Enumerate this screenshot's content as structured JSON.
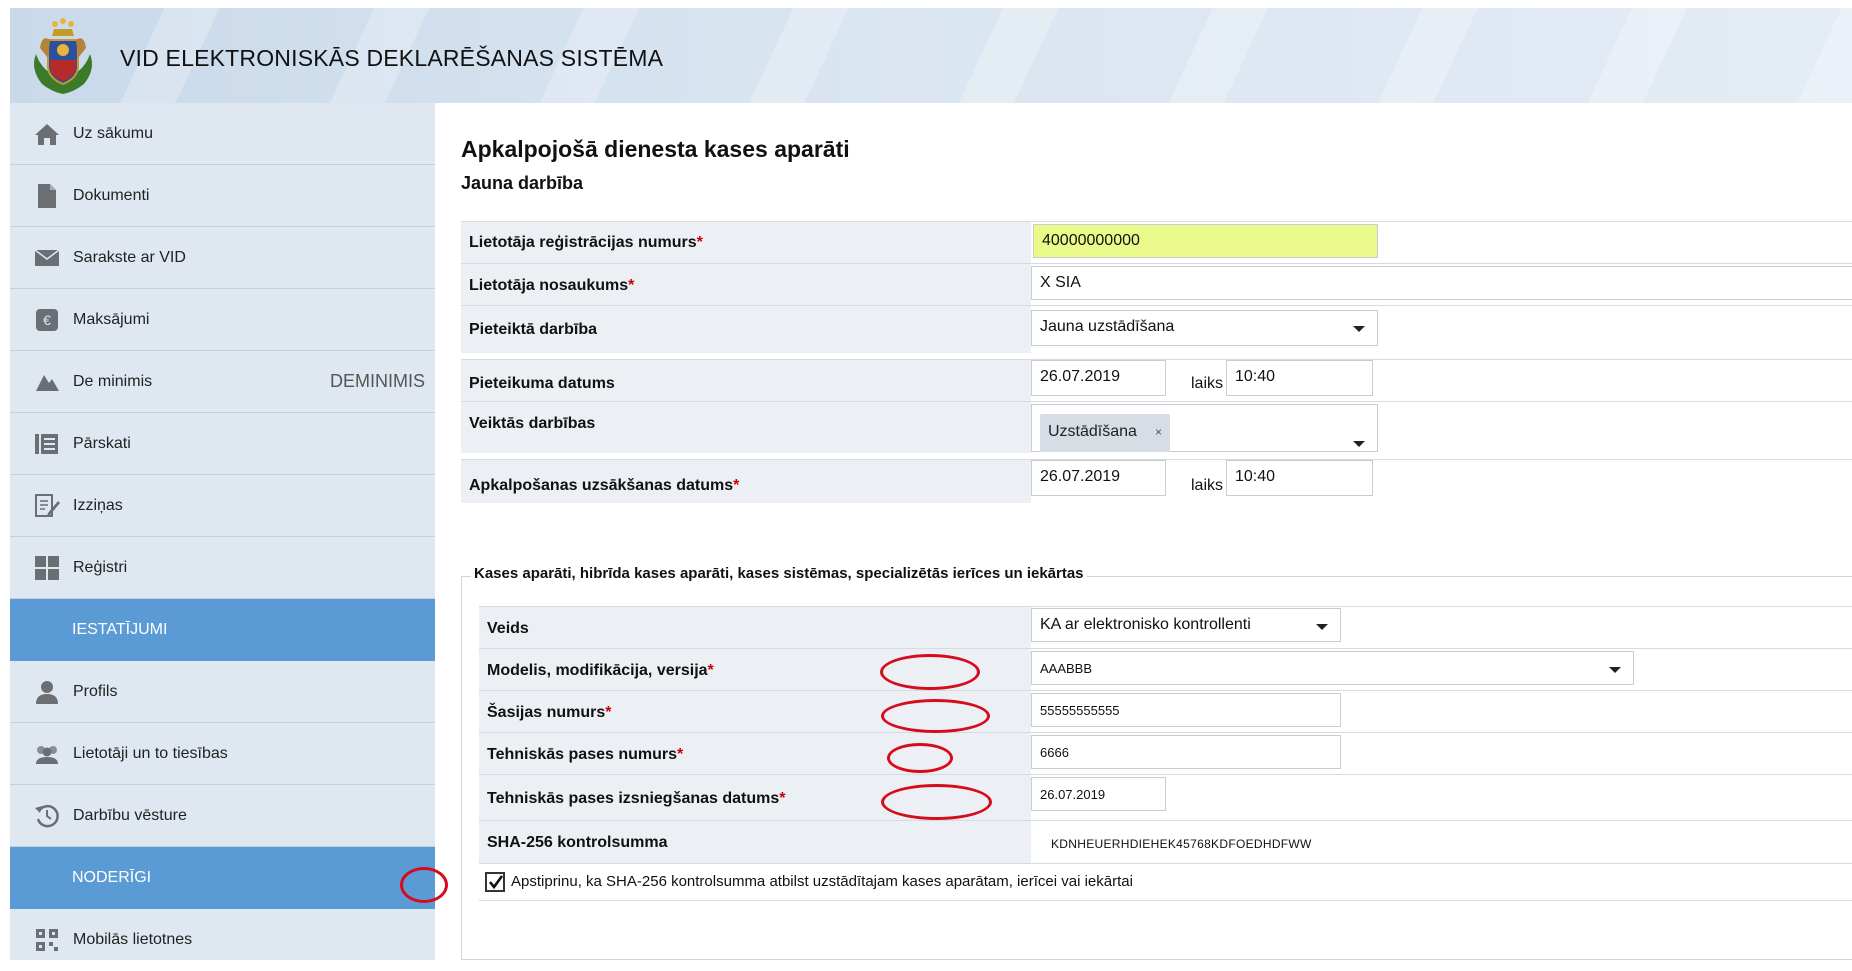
{
  "header": {
    "title": "VID ELEKTRONISKĀS DEKLARĒŠANAS SISTĒMA"
  },
  "sidebar": {
    "items": [
      {
        "label": "Uz sākumu",
        "icon": "home-icon"
      },
      {
        "label": "Dokumenti",
        "icon": "document-icon"
      },
      {
        "label": "Sarakste ar VID",
        "icon": "envelope-icon"
      },
      {
        "label": "Maksājumi",
        "icon": "euro-icon"
      },
      {
        "label": "De minimis",
        "icon": "scale-icon",
        "badge": "DEMINIMIS"
      },
      {
        "label": "Pārskati",
        "icon": "reports-icon"
      },
      {
        "label": "Izziņas",
        "icon": "certificate-icon"
      },
      {
        "label": "Reģistri",
        "icon": "grid-icon"
      }
    ],
    "section_settings": "IESTATĪJUMI",
    "settings_items": [
      {
        "label": "Profils",
        "icon": "user-icon"
      },
      {
        "label": "Lietotāji un to tiesības",
        "icon": "users-icon"
      },
      {
        "label": "Darbību vēsture",
        "icon": "history-icon"
      }
    ],
    "section_useful": "NODERĪGI",
    "useful_items": [
      {
        "label": "Mobilās lietotnes",
        "icon": "qr-icon"
      }
    ]
  },
  "main": {
    "title": "Apkalpojošā dienesta kases aparāti",
    "subtitle": "Jauna darbība",
    "fields": {
      "reg_number": {
        "label": "Lietotāja reģistrācijas numurs",
        "value": "40000000000"
      },
      "user_name": {
        "label": "Lietotāja nosaukums",
        "value": "X SIA"
      },
      "action": {
        "label": "Pieteiktā darbība",
        "value": "Jauna uzstādīšana"
      },
      "app_date": {
        "label": "Pieteikuma datums",
        "date": "26.07.2019",
        "time_label": "laiks",
        "time": "10:40"
      },
      "performed": {
        "label": "Veiktās darbības",
        "chip": "Uzstādīšana",
        "chip_remove": "×"
      },
      "service_start": {
        "label": "Apkalpošanas uzsākšanas datums",
        "date": "26.07.2019",
        "time_label": "laiks",
        "time": "10:40"
      }
    },
    "device_section": {
      "legend": "Kases aparāti, hibrīda kases aparāti, kases sistēmas, specializētās ierīces un iekārtas",
      "type": {
        "label": "Veids",
        "value": "KA ar elektronisko kontrollenti"
      },
      "model": {
        "label": "Modelis, modifikācija, versija",
        "value": "AAABBB"
      },
      "chassis": {
        "label": "Šasijas numurs",
        "value": "55555555555"
      },
      "passport_no": {
        "label": "Tehniskās pases numurs",
        "value": "6666"
      },
      "passport_date": {
        "label": "Tehniskās pases izsniegšanas datums",
        "value": "26.07.2019"
      },
      "sha": {
        "label": "SHA-256 kontrolsumma",
        "value": "KDNHEUERHDIEHEK45768KDFOEDHDFWW"
      },
      "confirm": {
        "label": "Apstiprinu, ka SHA-256 kontrolsumma atbilst uzstādītajam kases aparātam, ierīcei vai iekārtai",
        "checked": true
      }
    },
    "required_mark": "*"
  }
}
